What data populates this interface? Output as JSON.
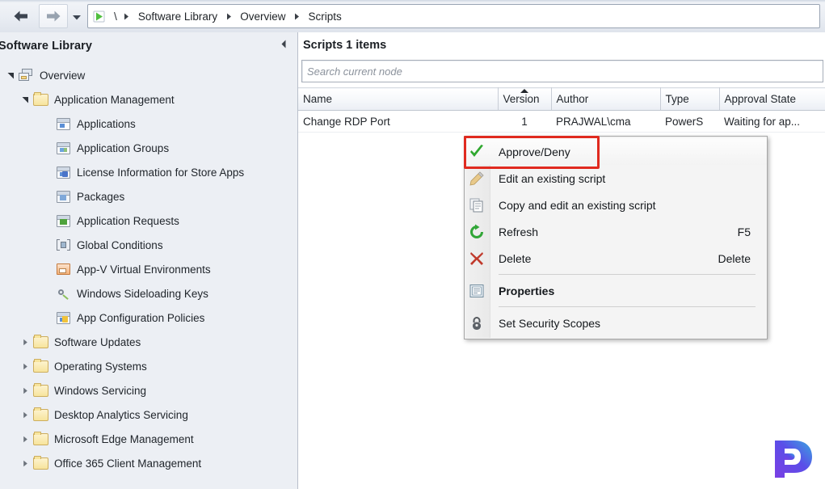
{
  "window": {
    "title": "Software Library"
  },
  "navbar": {
    "back_icon": "arrow-left-icon",
    "forward_icon": "arrow-right-icon",
    "history_dropdown_icon": "chevron-down-icon",
    "connection_icon": "green-play-icon",
    "root_label": "\\",
    "breadcrumb": [
      {
        "label": "Software Library"
      },
      {
        "label": "Overview"
      },
      {
        "label": "Scripts"
      }
    ]
  },
  "sidebar": {
    "title": "Software Library",
    "collapse_icon": "chevron-left-icon",
    "items": [
      {
        "label": "Overview",
        "level": 0,
        "twisty": "expanded",
        "icon": "overview-icon"
      },
      {
        "label": "Application Management",
        "level": 1,
        "twisty": "expanded",
        "icon": "folder-icon"
      },
      {
        "label": "Applications",
        "level": 2,
        "twisty": "none",
        "icon": "applications-icon"
      },
      {
        "label": "Application Groups",
        "level": 2,
        "twisty": "none",
        "icon": "application-groups-icon"
      },
      {
        "label": "License Information for Store Apps",
        "level": 2,
        "twisty": "none",
        "icon": "license-information-icon"
      },
      {
        "label": "Packages",
        "level": 2,
        "twisty": "none",
        "icon": "packages-icon"
      },
      {
        "label": "Application Requests",
        "level": 2,
        "twisty": "none",
        "icon": "application-requests-icon"
      },
      {
        "label": "Global Conditions",
        "level": 2,
        "twisty": "none",
        "icon": "global-conditions-icon"
      },
      {
        "label": "App-V Virtual Environments",
        "level": 2,
        "twisty": "none",
        "icon": "app-v-virtual-environments-icon"
      },
      {
        "label": "Windows Sideloading Keys",
        "level": 2,
        "twisty": "none",
        "icon": "windows-sideloading-keys-icon"
      },
      {
        "label": "App Configuration Policies",
        "level": 2,
        "twisty": "none",
        "icon": "app-configuration-policies-icon"
      },
      {
        "label": "Software Updates",
        "level": 1,
        "twisty": "collapsed",
        "icon": "folder-icon"
      },
      {
        "label": "Operating Systems",
        "level": 1,
        "twisty": "collapsed",
        "icon": "folder-icon"
      },
      {
        "label": "Windows Servicing",
        "level": 1,
        "twisty": "collapsed",
        "icon": "folder-icon"
      },
      {
        "label": "Desktop Analytics Servicing",
        "level": 1,
        "twisty": "collapsed",
        "icon": "folder-icon"
      },
      {
        "label": "Microsoft Edge Management",
        "level": 1,
        "twisty": "collapsed",
        "icon": "folder-icon"
      },
      {
        "label": "Office 365 Client Management",
        "level": 1,
        "twisty": "collapsed",
        "icon": "folder-icon"
      }
    ]
  },
  "main": {
    "heading": "Scripts 1 items",
    "search": {
      "placeholder": "Search current node",
      "value": ""
    },
    "table": {
      "columns": [
        {
          "label": "Name",
          "sorted": false
        },
        {
          "label": "Version",
          "sorted": true
        },
        {
          "label": "Author",
          "sorted": false
        },
        {
          "label": "Type",
          "sorted": false
        },
        {
          "label": "Approval State",
          "sorted": false
        }
      ],
      "rows": [
        {
          "name": "Change RDP Port",
          "version": "1",
          "author": "PRAJWAL\\cma",
          "type": "PowerS",
          "approval_state": "Waiting for ap..."
        }
      ]
    }
  },
  "context_menu": {
    "items": [
      {
        "label": "Approve/Deny",
        "shortcut": "",
        "icon": "green-check-icon",
        "bold": false,
        "highlighted": true,
        "separator_after": false
      },
      {
        "label": "Edit an existing script",
        "shortcut": "",
        "icon": "pencil-icon",
        "bold": false,
        "highlighted": false,
        "separator_after": false
      },
      {
        "label": "Copy and edit an existing script",
        "shortcut": "",
        "icon": "copy-icon",
        "bold": false,
        "highlighted": false,
        "separator_after": false
      },
      {
        "label": "Refresh",
        "shortcut": "F5",
        "icon": "refresh-icon",
        "bold": false,
        "highlighted": false,
        "separator_after": false
      },
      {
        "label": "Delete",
        "shortcut": "Delete",
        "icon": "red-x-icon",
        "bold": false,
        "highlighted": false,
        "separator_after": true
      },
      {
        "label": "Properties",
        "shortcut": "",
        "icon": "properties-icon",
        "bold": true,
        "highlighted": false,
        "separator_after": true
      },
      {
        "label": "Set Security Scopes",
        "shortcut": "",
        "icon": "lock-icon",
        "bold": false,
        "highlighted": false,
        "separator_after": false
      }
    ]
  },
  "annotation": {
    "highlight_color": "#e02a1f",
    "highlight_target": "Approve/Deny"
  },
  "watermark": {
    "letter": "P",
    "color_start": "#3aa8e0",
    "color_end": "#7b3fe4"
  }
}
